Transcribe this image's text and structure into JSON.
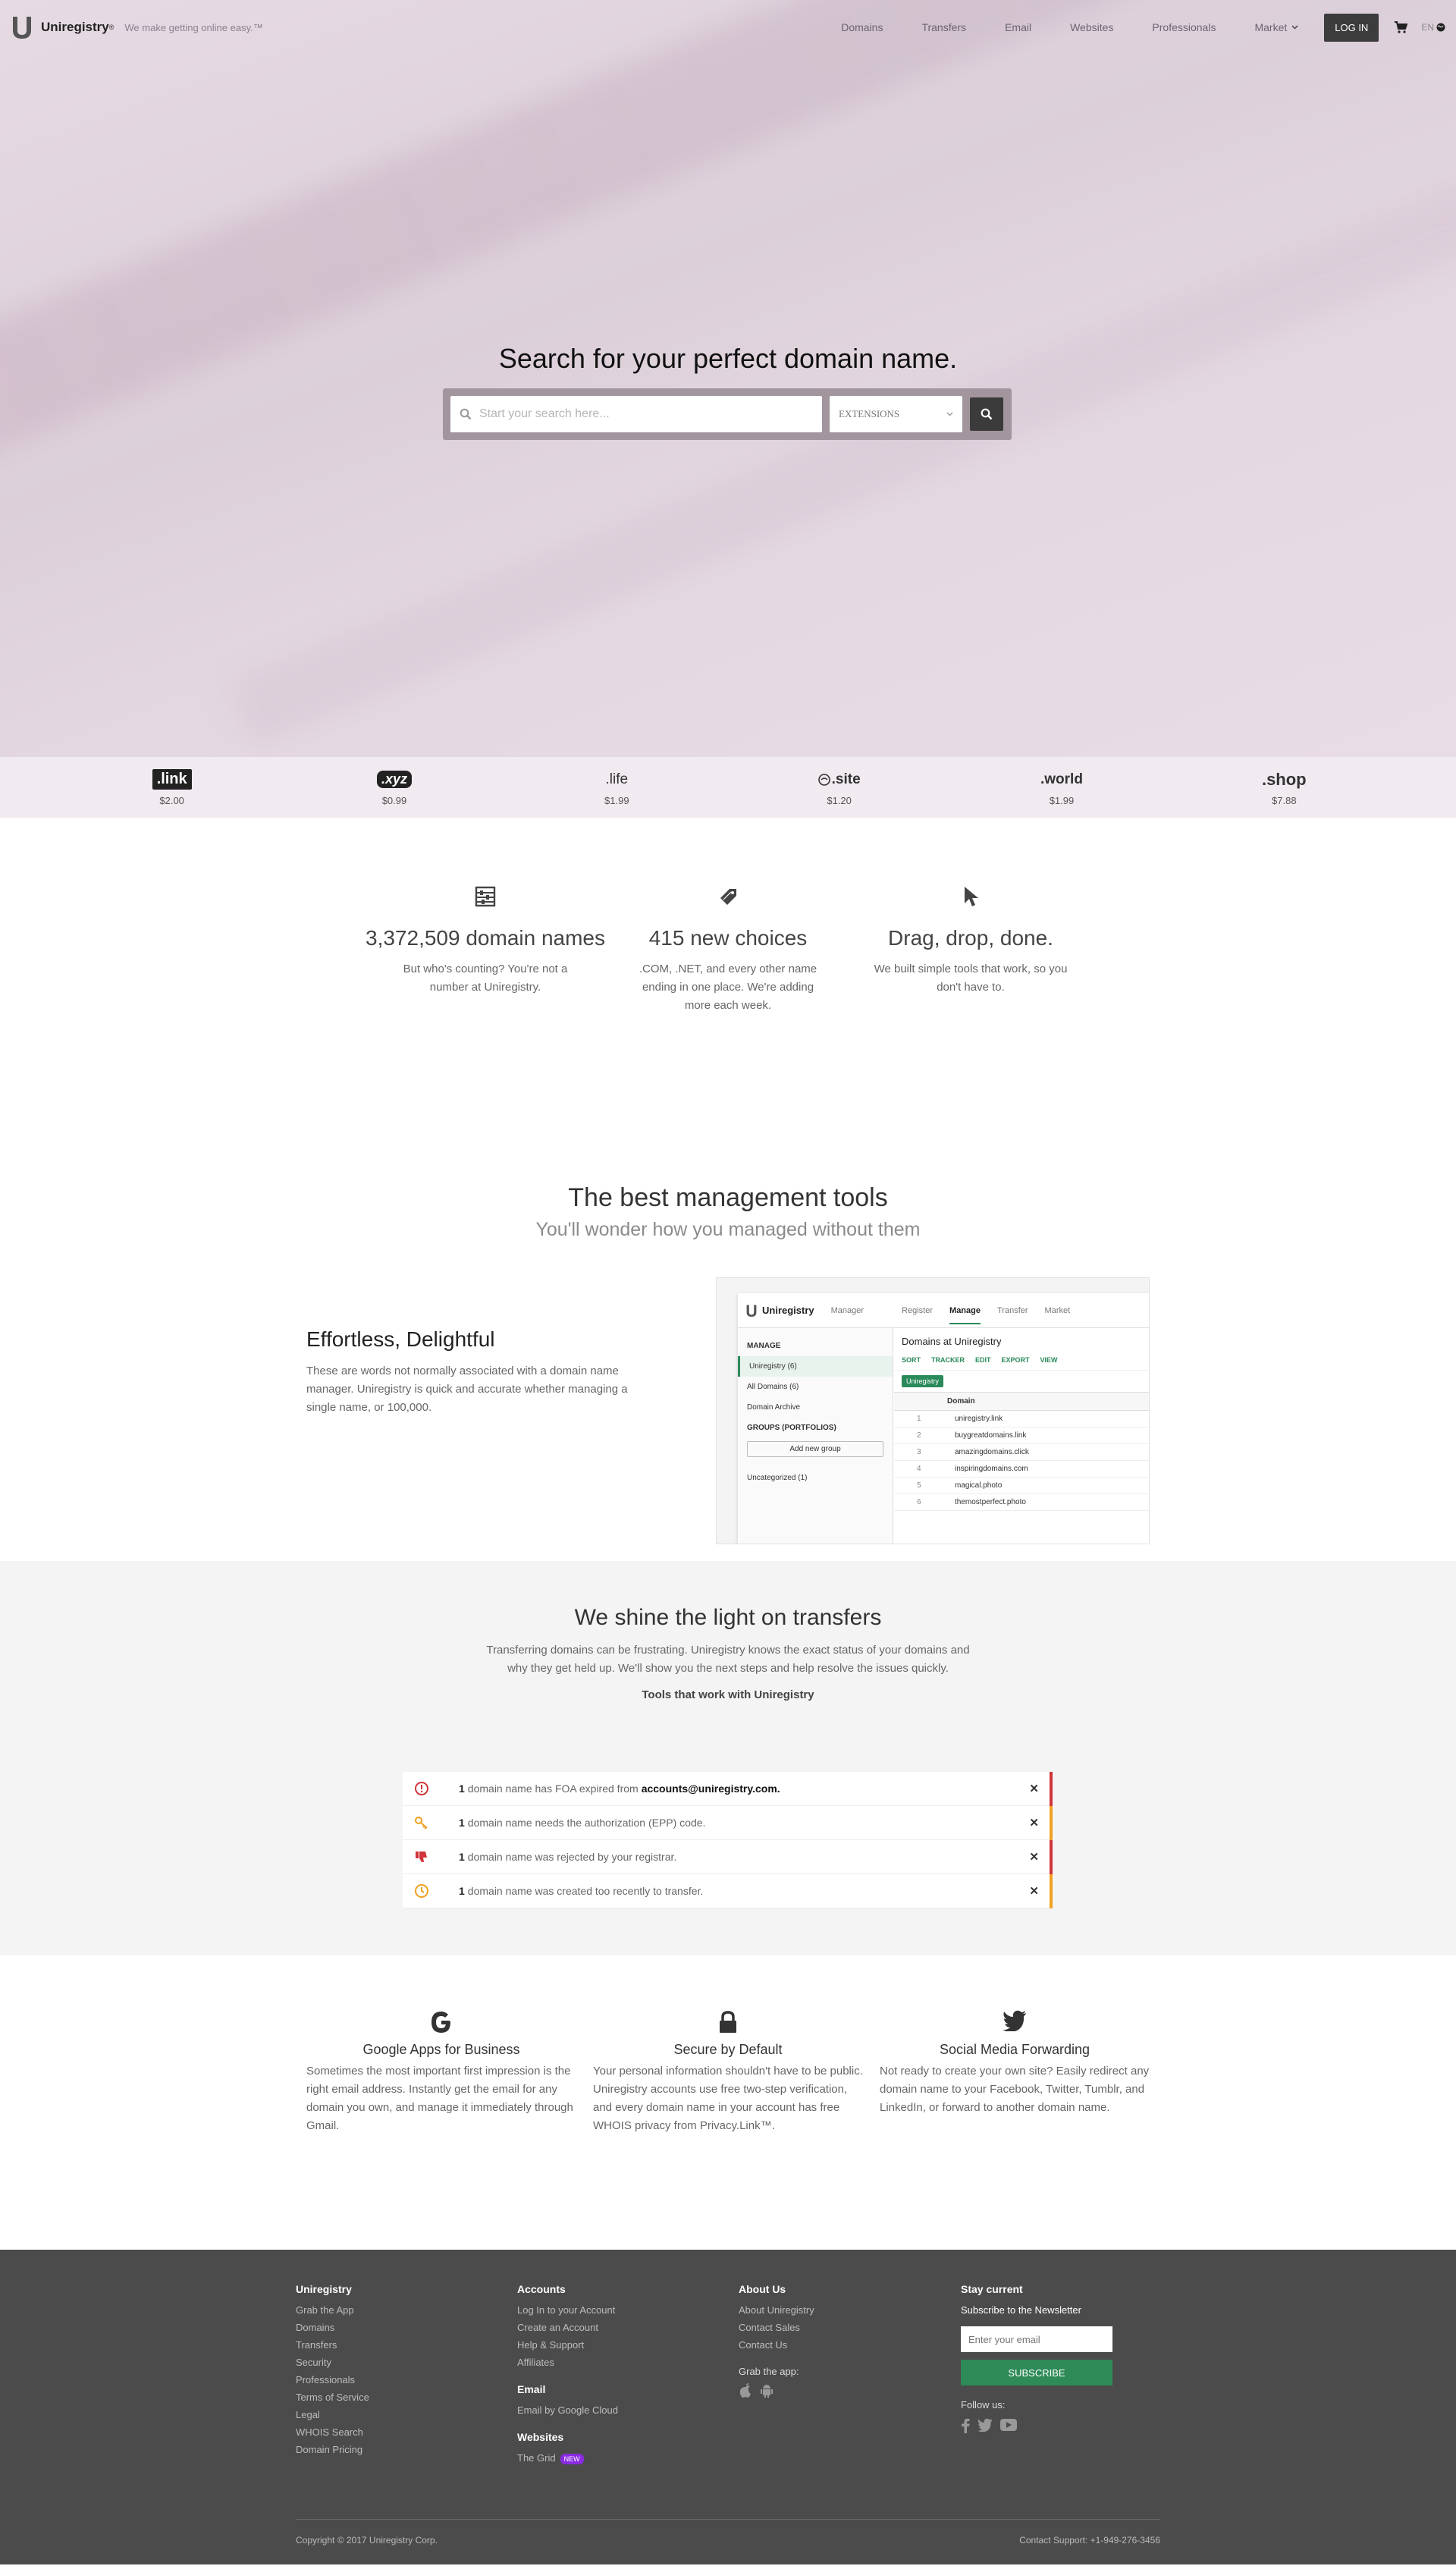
{
  "nav": {
    "brand": "Uniregistry",
    "tm": "®",
    "tagline": "We make getting online easy.™",
    "links": [
      "Domains",
      "Transfers",
      "Email",
      "Websites",
      "Professionals"
    ],
    "market": "Market",
    "login": "LOG IN",
    "lang": "EN"
  },
  "hero": {
    "title": "Search for your perfect domain name.",
    "search_placeholder": "Start your search here...",
    "extensions_label": "EXTENSIONS"
  },
  "extensions": [
    {
      "name": ".link",
      "price": "$2.00"
    },
    {
      "name": ".xyz",
      "price": "$0.99"
    },
    {
      "name": ".life",
      "price": "$1.99"
    },
    {
      "name": ".site",
      "price": "$1.20"
    },
    {
      "name": ".world",
      "price": "$1.99"
    },
    {
      "name": ".shop",
      "price": "$7.88"
    }
  ],
  "features": [
    {
      "icon": "abacus-icon",
      "title": "3,372,509 domain names",
      "text": "But who's counting? You're not a number at Uniregistry."
    },
    {
      "icon": "tag-icon",
      "title": "415 new choices",
      "text": ".COM, .NET, and every other name ending in one place. We're adding more each week."
    },
    {
      "icon": "cursor-icon",
      "title": "Drag, drop, done.",
      "text": "We built simple tools that work, so you don't have to."
    }
  ],
  "management": {
    "title": "The best management tools",
    "subtitle": "You'll wonder how you managed without them",
    "heading": "Effortless, Delightful",
    "text": "These are words not normally associated with a domain name manager.  Uniregistry is quick and accurate whether managing a single name, or 100,000.",
    "shot": {
      "brand": "Uniregistry",
      "tabs": [
        "Manager",
        "Register",
        "Manage",
        "Transfer",
        "Market"
      ],
      "manage": "MANAGE",
      "side": [
        "Uniregistry (6)",
        "All Domains (6)",
        "Domain Archive"
      ],
      "groups": "GROUPS (PORTFOLIOS)",
      "add_group": "Add new group",
      "uncategorized": "Uncategorized (1)",
      "main_title": "Domains at Uniregistry",
      "tools": [
        "SORT",
        "TRACKER",
        "EDIT",
        "EXPORT",
        "VIEW"
      ],
      "tag": "Uniregistry",
      "col": "Domain",
      "domains": [
        "uniregistry.link",
        "buygreatdomains.link",
        "amazingdomains.click",
        "inspiringdomains.com",
        "magical.photo",
        "themostperfect.photo"
      ]
    }
  },
  "transfers": {
    "title": "We shine the light on transfers",
    "text": "Transferring domains can be frustrating.  Uniregistry knows the exact status of your domains and why they get held up.  We'll show you the next steps and help resolve the issues quickly.",
    "tools": "Tools that work with Uniregistry",
    "alerts": [
      {
        "count": "1",
        "text": "domain name has FOA expired from",
        "email": "accounts@uniregistry.com.",
        "color": "#d0343a",
        "icon": "alert-circle-icon"
      },
      {
        "count": "1",
        "text": "domain name needs the authorization (EPP) code.",
        "email": "",
        "color": "#f0a020",
        "icon": "key-icon"
      },
      {
        "count": "1",
        "text": "domain name was rejected by your registrar.",
        "email": "",
        "color": "#d0343a",
        "icon": "thumbs-down-icon"
      },
      {
        "count": "1",
        "text": "domain name was created too recently to transfer.",
        "email": "",
        "color": "#f0a020",
        "icon": "clock-icon"
      }
    ]
  },
  "info": [
    {
      "icon": "google-icon",
      "title": "Google Apps for Business",
      "text": "Sometimes the most important first impression is the right email address. Instantly get the email for any domain you own, and manage it immediately through Gmail."
    },
    {
      "icon": "lock-icon",
      "title": "Secure by Default",
      "text": "Your personal information shouldn't have to be public. Uniregistry accounts use free two-step verification, and every domain name in your account has free WHOIS privacy from Privacy.Link™."
    },
    {
      "icon": "twitter-icon",
      "title": "Social Media Forwarding",
      "text": "Not ready to create your own site? Easily redirect any domain name to your Facebook, Twitter, Tumblr, and LinkedIn, or forward to another domain name."
    }
  ],
  "footer": {
    "col1": {
      "title": "Uniregistry",
      "links": [
        "Grab the App",
        "Domains",
        "Transfers",
        "Security",
        "Professionals",
        "Terms of Service",
        "Legal",
        "WHOIS Search",
        "Domain Pricing"
      ]
    },
    "col2": {
      "title": "Accounts",
      "links": [
        "Log In to your Account",
        "Create an Account",
        "Help & Support",
        "Affiliates"
      ],
      "email_title": "Email",
      "email_link": "Email by Google Cloud",
      "websites_title": "Websites",
      "grid": "The Grid",
      "new": "NEW"
    },
    "col3": {
      "title": "About Us",
      "links": [
        "About Uniregistry",
        "Contact Sales",
        "Contact Us"
      ],
      "app_title": "Grab the app:"
    },
    "col4": {
      "title": "Stay current",
      "subtitle": "Subscribe to the Newsletter",
      "placeholder": "Enter your email",
      "button": "SUBSCRIBE",
      "follow": "Follow us:"
    },
    "copyright": "Copyright © 2017 Uniregistry Corp.",
    "support": "Contact Support: +1-949-276-3456"
  }
}
